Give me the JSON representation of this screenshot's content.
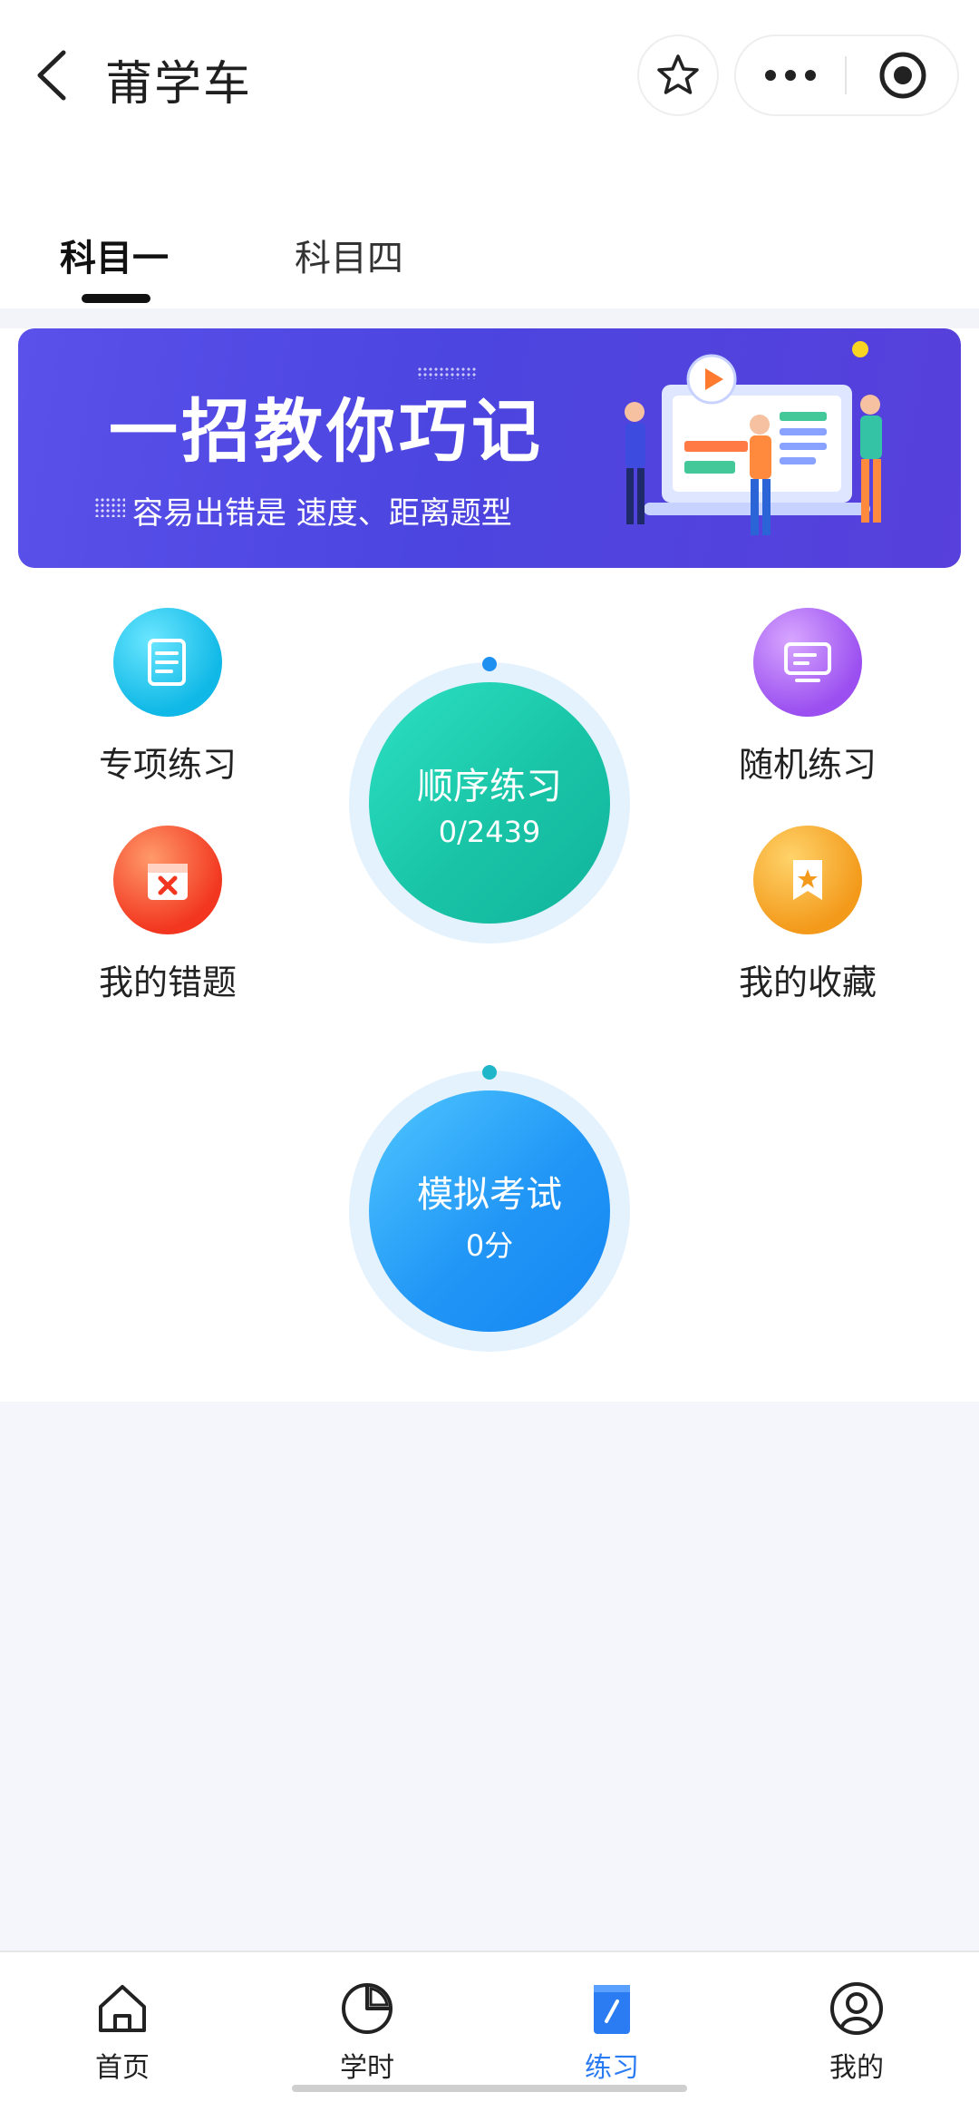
{
  "header": {
    "title": "莆学车",
    "back_icon": "back-arrow-icon",
    "favorite_icon": "star-icon",
    "more_icon": "more-dots-icon",
    "close_icon": "target-icon"
  },
  "tabs": [
    {
      "label": "科目一",
      "active": true
    },
    {
      "label": "科目四",
      "active": false
    }
  ],
  "banner": {
    "title": "一招教你巧记",
    "subtitle": "容易出错是 速度、距离题型",
    "accent_color": "#4c45df"
  },
  "features": {
    "special": {
      "label": "专项练习",
      "icon": "scroll-document-icon",
      "color": "#1ec6ea"
    },
    "random": {
      "label": "随机练习",
      "icon": "monitor-icon",
      "color": "#a55df0"
    },
    "wrong": {
      "label": "我的错题",
      "icon": "calendar-x-icon",
      "color": "#f4442e"
    },
    "favorites": {
      "label": "我的收藏",
      "icon": "bookmark-star-icon",
      "color": "#f6a623"
    }
  },
  "sequential": {
    "title": "顺序练习",
    "progress": "0/2439",
    "done": 0,
    "total": 2439
  },
  "mock_exam": {
    "title": "模拟考试",
    "score": "0分"
  },
  "bottom_nav": {
    "items": [
      {
        "label": "首页",
        "icon": "home-icon",
        "active": false
      },
      {
        "label": "学时",
        "icon": "pie-chart-icon",
        "active": false
      },
      {
        "label": "练习",
        "icon": "notebook-pencil-icon",
        "active": true
      },
      {
        "label": "我的",
        "icon": "user-icon",
        "active": false
      }
    ],
    "active_color": "#2b7cf2"
  }
}
